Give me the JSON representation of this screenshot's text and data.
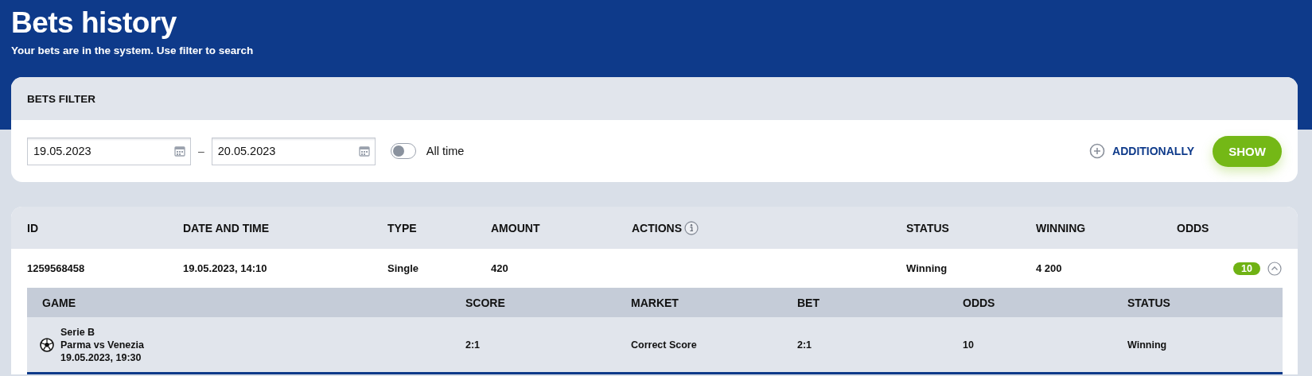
{
  "header": {
    "title": "Bets history",
    "subtitle": "Your bets are in the system. Use filter to search"
  },
  "filter": {
    "title": "BETS FILTER",
    "date_from": "19.05.2023",
    "separator": "–",
    "date_to": "20.05.2023",
    "toggle": {
      "label": "All time",
      "on": false
    },
    "additionally": "ADDITIONALLY",
    "show_button": "SHOW"
  },
  "bets_table": {
    "columns": [
      {
        "label": "ID",
        "kind": "plain"
      },
      {
        "label": "DATE AND TIME",
        "kind": "plain"
      },
      {
        "label": "TYPE",
        "kind": "plain"
      },
      {
        "label": "AMOUNT",
        "kind": "plain"
      },
      {
        "label": "ACTIONS",
        "kind": "info"
      },
      {
        "label": "STATUS",
        "kind": "plain"
      },
      {
        "label": "WINNING",
        "kind": "plain"
      },
      {
        "label": "ODDS",
        "kind": "plain"
      }
    ],
    "rows": [
      {
        "id": "1259568458",
        "date_time": "19.05.2023, 14:10",
        "type": "Single",
        "amount": "420",
        "status": "Winning",
        "winning": "4 200",
        "odds": "10",
        "expanded": true,
        "details": {
          "columns": [
            "GAME",
            "SCORE",
            "MARKET",
            "BET",
            "ODDS",
            "STATUS"
          ],
          "rows": [
            {
              "league": "Serie B",
              "match": "Parma vs Venezia",
              "date_time": "19.05.2023, 19:30",
              "score": "2:1",
              "market": "Correct Score",
              "bet": "2:1",
              "odds": "10",
              "status": "Winning"
            }
          ]
        }
      }
    ]
  }
}
